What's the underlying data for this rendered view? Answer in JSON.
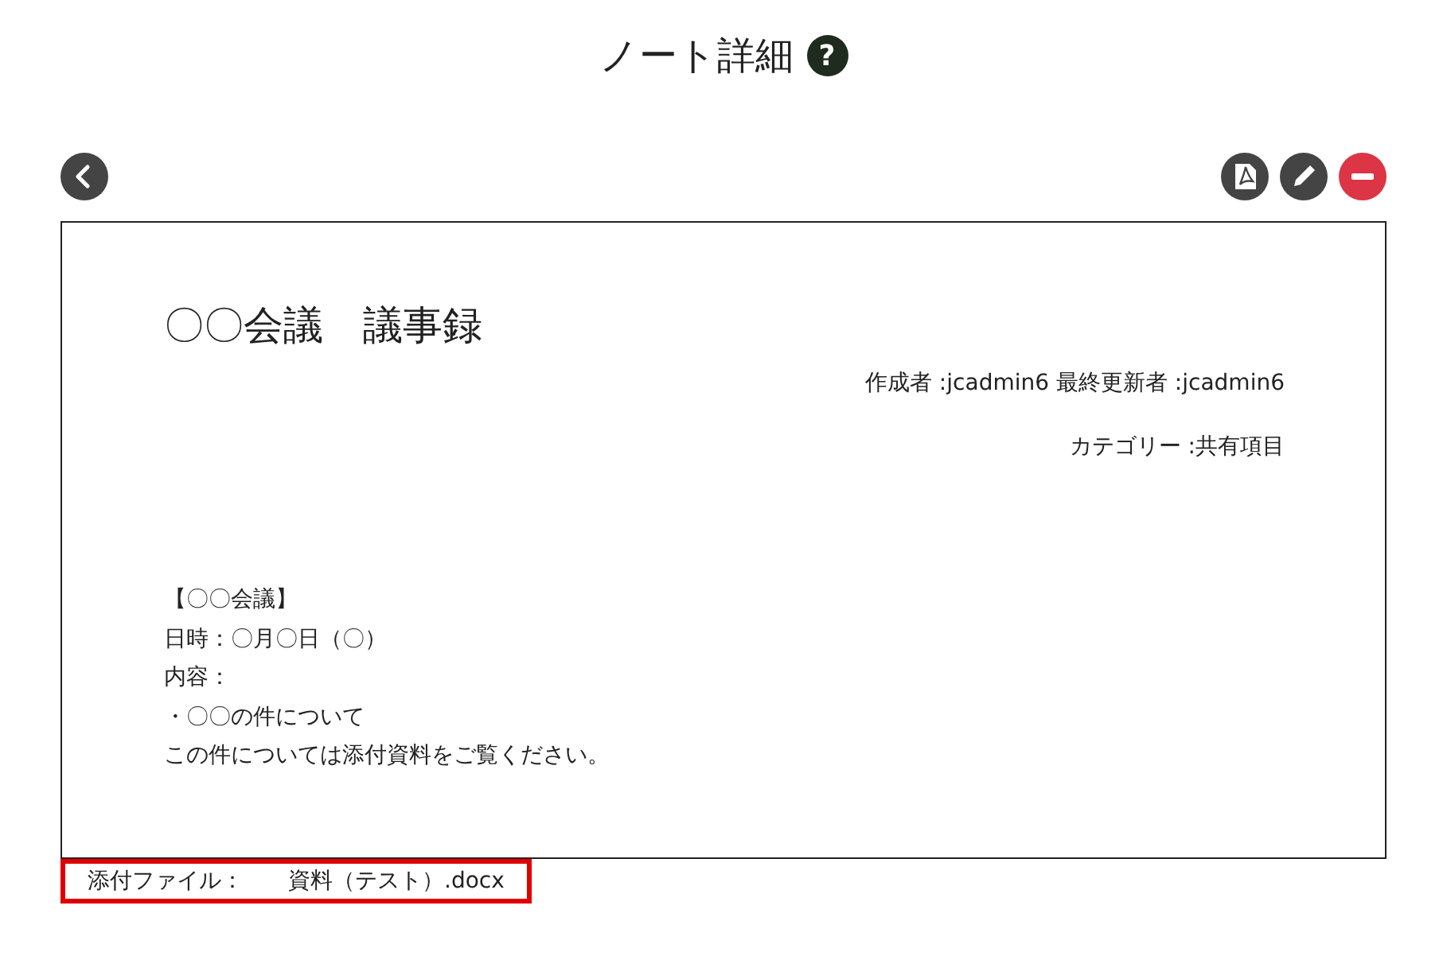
{
  "page": {
    "title": "ノート詳細",
    "help_icon": "?"
  },
  "toolbar": {
    "left": [
      {
        "kind": "back"
      }
    ],
    "right": [
      {
        "kind": "pdf"
      },
      {
        "kind": "edit"
      },
      {
        "kind": "delete"
      }
    ]
  },
  "note": {
    "title": "〇〇会議　議事録",
    "meta": [
      "作成者 :jcadmin6 最終更新者 :jcadmin6",
      "カテゴリー :共有項目"
    ],
    "body": [
      "【〇〇会議】",
      "日時：〇月〇日（〇）",
      "内容：",
      "・〇〇の件について",
      "この件については添付資料をご覧ください。"
    ]
  },
  "attachment": {
    "label": "添付ファイル：",
    "file": "資料（テスト）.docx",
    "highlighted": true
  }
}
